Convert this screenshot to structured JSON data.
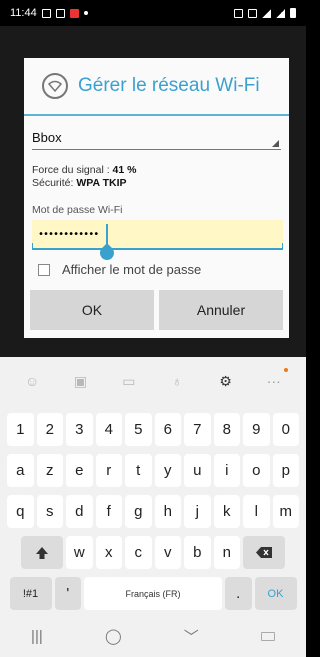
{
  "status_bar": {
    "time": "11:44"
  },
  "dialog": {
    "title": "Gérer le réseau Wi-Fi",
    "network": "Bbox",
    "signal_label": "Force du signal : ",
    "signal_value": "41 %",
    "security_label": "Sécurité: ",
    "security_value": "WPA TKIP",
    "password_label": "Mot de passe Wi-Fi",
    "password_value": "••••••••••••",
    "show_password_label": "Afficher le mot de passe",
    "ok_label": "OK",
    "cancel_label": "Annuler"
  },
  "keyboard": {
    "number_row": [
      "1",
      "2",
      "3",
      "4",
      "5",
      "6",
      "7",
      "8",
      "9",
      "0"
    ],
    "row1": [
      "a",
      "z",
      "e",
      "r",
      "t",
      "y",
      "u",
      "i",
      "o",
      "p"
    ],
    "row2": [
      "q",
      "s",
      "d",
      "f",
      "g",
      "h",
      "j",
      "k",
      "l",
      "m"
    ],
    "row3": [
      "w",
      "x",
      "c",
      "v",
      "b",
      "n"
    ],
    "symbols_label": "!#1",
    "apostrophe": "'",
    "space_label": "Français (FR)",
    "period": ".",
    "ok_label": "OK"
  },
  "colors": {
    "accent": "#3aa1cf",
    "field_bg": "#fff8c6",
    "notification_dot": "#f07a1a"
  }
}
